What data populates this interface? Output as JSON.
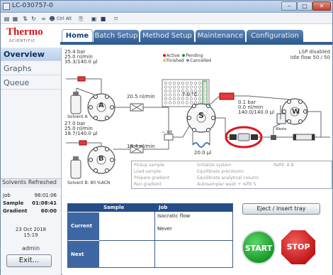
{
  "window": {
    "title": "LC-030757-0",
    "minimize": "–",
    "maximize": "□",
    "close": "✕"
  },
  "toolbar_icons": [
    "clipboard-icon",
    "document-icon",
    "sort-icon",
    "refresh-icon",
    "link-icon",
    "user-icon",
    "alert-ctrl-icon",
    "copy-icon",
    "chart-icon",
    "save-icon",
    "settings-icon"
  ],
  "logo": {
    "brand": "Thermo",
    "sub": "SCIENTIFIC"
  },
  "tabs": [
    {
      "label": "Home",
      "active": true
    },
    {
      "label": "Batch Setup",
      "active": false
    },
    {
      "label": "Method Setup",
      "active": false
    },
    {
      "label": "Maintenance",
      "active": false
    },
    {
      "label": "Configuration",
      "active": false
    }
  ],
  "sidebar": {
    "items": [
      {
        "label": "Overview",
        "active": true
      },
      {
        "label": "Graphs",
        "active": false
      },
      {
        "label": "Queue",
        "active": false
      }
    ],
    "solvents_refreshed": "Solvents Refreshed",
    "rows": [
      {
        "label": "Job",
        "value": "98:01:06"
      },
      {
        "label": "Sample",
        "value": "01:08:41"
      },
      {
        "label": "Gradient",
        "value": "60:00"
      }
    ],
    "date": "23 Oct 2018",
    "time": "15:19",
    "user": "admin",
    "exit_label": "Exit..."
  },
  "status": {
    "lsp": "LSP disabled",
    "idle_flow": "Idle flow 50 / 50"
  },
  "pump_a": {
    "pressure": "25.4 bar",
    "flow": "25.0 nl/min",
    "volume": "35.3/140.0 µl",
    "label": "A",
    "valve_flow": "20.5 nl/min",
    "solvent": "Solvent A"
  },
  "pump_b": {
    "pressure": "27.0 bar",
    "flow": "25.0 nl/min",
    "volume": "18.7/140.0 µl",
    "label": "B",
    "valve_flow": "19.4 nl/min",
    "solvent": "Solvent B: 80 %ACN"
  },
  "legend": {
    "active": "Active",
    "finished": "Finished",
    "pending": "Pending",
    "cancelled": "Cancelled"
  },
  "autosampler": {
    "temp": "7.0 °C",
    "label": "S",
    "loop": "20.0 µl",
    "mixer": "~ XB"
  },
  "pump_w": {
    "pressure": "0.1 bar",
    "flow": "0.0 nl/min",
    "volume": "140.0/140.0 µl",
    "label": "W",
    "waste": "Waste"
  },
  "steps": {
    "col1": [
      "Pickup sample",
      "Load sample",
      "Prepare gradient",
      "Run gradient"
    ],
    "col2": [
      "Initialize system",
      "Equilibrate precolumn",
      "Equilibrate analytical column",
      "Autosampler wash + refill S"
    ],
    "refill": "Refill: A  B"
  },
  "job_table": {
    "headers": [
      "Sample",
      "Job"
    ],
    "current_label": "Current",
    "current_job": "Isocratic flow",
    "current_job2": "Never",
    "next_label": "Next"
  },
  "eject_label": "Eject / Insert tray",
  "start_label": "START",
  "stop_label": "STOP",
  "colors": {
    "accent": "#325d93",
    "highlight": "#e0141a",
    "start": "#189a2a",
    "stop": "#c2171a"
  }
}
